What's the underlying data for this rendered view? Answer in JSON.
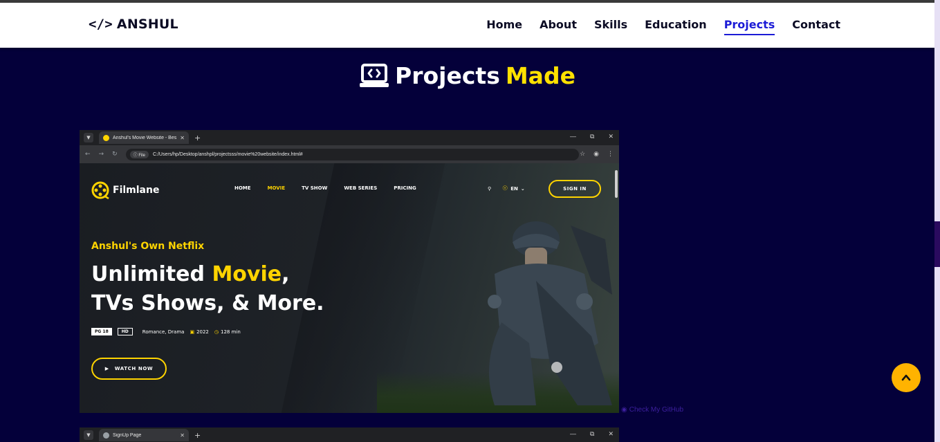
{
  "navbar": {
    "logo_text": "ANSHUL",
    "logo_icon": "code-icon",
    "links": [
      {
        "label": "Home"
      },
      {
        "label": "About"
      },
      {
        "label": "Skills"
      },
      {
        "label": "Education"
      },
      {
        "label": "Projects",
        "active": true
      },
      {
        "label": "Contact"
      }
    ]
  },
  "section": {
    "icon": "laptop-code-icon",
    "title_main": "Projects",
    "title_accent": "Made"
  },
  "project1": {
    "browser": {
      "tab_title": "Anshul's Movie Website - Best ...",
      "file_chip": "File",
      "url": "C:/Users/hp/Desktop/anshpl/projectsss/movie%20website/index.html#"
    },
    "site": {
      "brand": "Filmlane",
      "menu": [
        "HOME",
        "MOVIE",
        "TV SHOW",
        "WEB SERIES",
        "PRICING"
      ],
      "active_menu": "MOVIE",
      "lang": "EN",
      "sign_in": "SIGN IN",
      "kicker": "Anshul's Own Netflix",
      "title_line1_a": "Unlimited ",
      "title_line1_hl": "Movie",
      "title_line1_b": ",",
      "title_line2": "TVs Shows, & More.",
      "badge_rating": "PG 18",
      "badge_quality": "HD",
      "genres": "Romance,  Drama",
      "year": "2022",
      "duration": "128 min",
      "watch_now": "WATCH NOW"
    },
    "github_link": "Check My GitHub"
  },
  "project2": {
    "browser": {
      "tab_title": "SignUp Page"
    }
  },
  "colors": {
    "page_bg": "#04003a",
    "accent_yellow": "#ffe100",
    "nav_active": "#1b1bd6",
    "scroll_top_btn": "#ffb300"
  }
}
